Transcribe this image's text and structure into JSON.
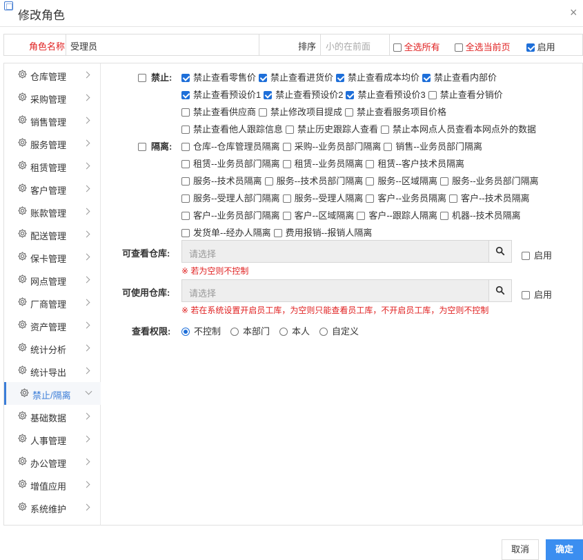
{
  "dialog": {
    "title": "修改角色",
    "close": "×"
  },
  "toprow": {
    "role_name_label": "角色名称",
    "role_name_value": "受理员",
    "order_label": "排序",
    "order_placeholder": "小的在前面",
    "select_all": {
      "label": "全选所有",
      "checked": false
    },
    "select_page": {
      "label": "全选当前页",
      "checked": false
    },
    "enable": {
      "label": "启用",
      "checked": true
    }
  },
  "sidebar": {
    "active_index": 14,
    "items": [
      {
        "label": "仓库管理"
      },
      {
        "label": "采购管理"
      },
      {
        "label": "销售管理"
      },
      {
        "label": "服务管理"
      },
      {
        "label": "租赁管理"
      },
      {
        "label": "客户管理"
      },
      {
        "label": "账款管理"
      },
      {
        "label": "配送管理"
      },
      {
        "label": "保卡管理"
      },
      {
        "label": "网点管理"
      },
      {
        "label": "厂商管理"
      },
      {
        "label": "资产管理"
      },
      {
        "label": "统计分析"
      },
      {
        "label": "统计导出"
      },
      {
        "label": "禁止/隔离"
      },
      {
        "label": "基础数据"
      },
      {
        "label": "人事管理"
      },
      {
        "label": "办公管理"
      },
      {
        "label": "增值应用"
      },
      {
        "label": "系统维护"
      }
    ]
  },
  "forbid": {
    "label": "禁止:",
    "checked": false,
    "rows": [
      [
        {
          "label": "禁止查看零售价",
          "checked": true
        },
        {
          "label": "禁止查看进货价",
          "checked": true
        },
        {
          "label": "禁止查看成本均价",
          "checked": true
        },
        {
          "label": "禁止查看内部价",
          "checked": true
        }
      ],
      [
        {
          "label": "禁止查看预设价1",
          "checked": true
        },
        {
          "label": "禁止查看预设价2",
          "checked": true
        },
        {
          "label": "禁止查看预设价3",
          "checked": true
        },
        {
          "label": "禁止查看分销价",
          "checked": false
        }
      ],
      [
        {
          "label": "禁止查看供应商",
          "checked": false
        },
        {
          "label": "禁止修改项目提成",
          "checked": false
        },
        {
          "label": "禁止查看服务项目价格",
          "checked": false
        }
      ],
      [
        {
          "label": "禁止查看他人跟踪信息",
          "checked": false
        },
        {
          "label": "禁止历史跟踪人查看",
          "checked": false
        },
        {
          "label": "禁止本网点人员查看本网点外的数据",
          "checked": false
        }
      ]
    ]
  },
  "isolate": {
    "label": "隔离:",
    "checked": false,
    "rows": [
      [
        {
          "label": "仓库--仓库管理员隔离",
          "checked": false
        },
        {
          "label": "采购--业务员部门隔离",
          "checked": false
        },
        {
          "label": "销售--业务员部门隔离",
          "checked": false
        }
      ],
      [
        {
          "label": "租赁--业务员部门隔离",
          "checked": false
        },
        {
          "label": "租赁--业务员隔离",
          "checked": false
        },
        {
          "label": "租赁--客户技术员隔离",
          "checked": false
        }
      ],
      [
        {
          "label": "服务--技术员隔离",
          "checked": false
        },
        {
          "label": "服务--技术员部门隔离",
          "checked": false
        },
        {
          "label": "服务--区域隔离",
          "checked": false
        },
        {
          "label": "服务--业务员部门隔离",
          "checked": false
        }
      ],
      [
        {
          "label": "服务--受理人部门隔离",
          "checked": false
        },
        {
          "label": "服务--受理人隔离",
          "checked": false
        },
        {
          "label": "客户--业务员隔离",
          "checked": false
        },
        {
          "label": "客户--技术员隔离",
          "checked": false
        }
      ],
      [
        {
          "label": "客户--业务员部门隔离",
          "checked": false
        },
        {
          "label": "客户--区域隔离",
          "checked": false
        },
        {
          "label": "客户--跟踪人隔离",
          "checked": false
        },
        {
          "label": "机器--技术员隔离",
          "checked": false
        }
      ],
      [
        {
          "label": "发货单--经办人隔离",
          "checked": false
        },
        {
          "label": "费用报销--报销人隔离",
          "checked": false
        }
      ]
    ]
  },
  "view_warehouse": {
    "label": "可查看仓库:",
    "placeholder": "请选择",
    "enable_label": "启用",
    "enable_checked": false,
    "note": "※ 若为空则不控制"
  },
  "use_warehouse": {
    "label": "可使用仓库:",
    "placeholder": "请选择",
    "enable_label": "启用",
    "enable_checked": false,
    "note": "※ 若在系统设置开启员工库，为空则只能查看员工库，不开启员工库，为空则不控制"
  },
  "view_perm": {
    "label": "查看权限:",
    "selected": 0,
    "options": [
      "不控制",
      "本部门",
      "本人",
      "自定义"
    ]
  },
  "footer": {
    "cancel": "取消",
    "ok": "确定"
  },
  "colors": {
    "accent": "#1e6fd9",
    "danger": "#e02020",
    "ok_button": "#3b8ef0"
  }
}
